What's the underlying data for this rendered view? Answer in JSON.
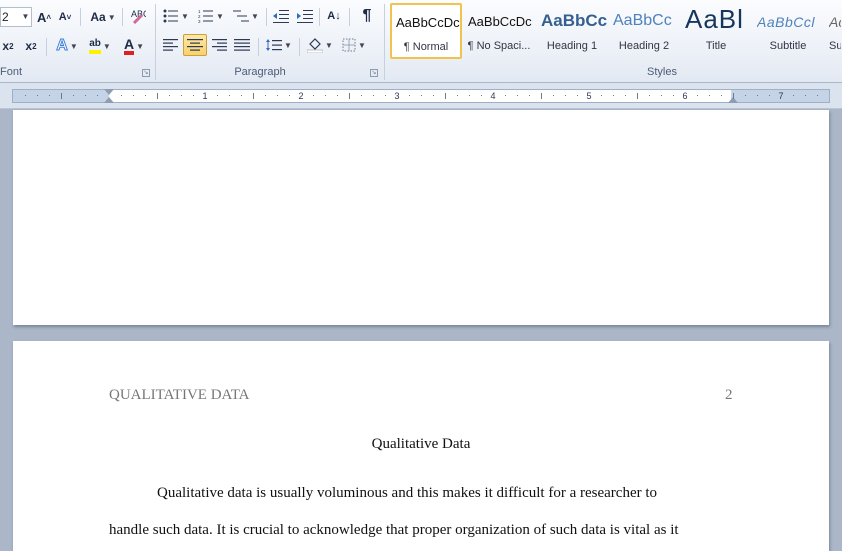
{
  "ribbon": {
    "font": {
      "size_value": "2",
      "grow_label": "A",
      "shrink_label": "A",
      "change_case_label": "Aa",
      "subscript_label": "x",
      "superscript_label": "x",
      "text_effects_label": "A",
      "highlight_label": "ab",
      "font_color_label": "A",
      "group_label": "Font"
    },
    "paragraph": {
      "sort_label": "A↓",
      "pilcrow_label": "¶",
      "group_label": "Paragraph"
    },
    "styles": {
      "group_label": "Styles",
      "items": [
        {
          "sample": "AaBbCcDc",
          "name": "¶ Normal"
        },
        {
          "sample": "AaBbCcDc",
          "name": "¶ No Spaci..."
        },
        {
          "sample": "AaBbCc",
          "name": "Heading 1"
        },
        {
          "sample": "AaBbCc",
          "name": "Heading 2"
        },
        {
          "sample": "AaBl",
          "name": "Title"
        },
        {
          "sample": "AaBbCcl",
          "name": "Subtitle"
        },
        {
          "sample": "Ac",
          "name": "Su"
        }
      ]
    }
  },
  "ruler": {
    "numbers": [
      "1",
      "2",
      "3",
      "4",
      "5",
      "6",
      "7"
    ]
  },
  "document": {
    "running_head": "QUALITATIVE DATA",
    "page_number": "2",
    "title": "Qualitative Data",
    "lines": [
      "Qualitative data is usually voluminous and this makes it difficult for a researcher to",
      "handle such data. It is crucial to acknowledge that proper organization of such data is vital as it"
    ]
  },
  "colors": {
    "ribbon_bg": "#eef2f8",
    "app_bg": "#abb7c8",
    "selected_style_border": "#f2c24e",
    "active_button": "#f9d06d",
    "font_color_red": "#e02020",
    "highlight_yellow": "#fff200"
  }
}
